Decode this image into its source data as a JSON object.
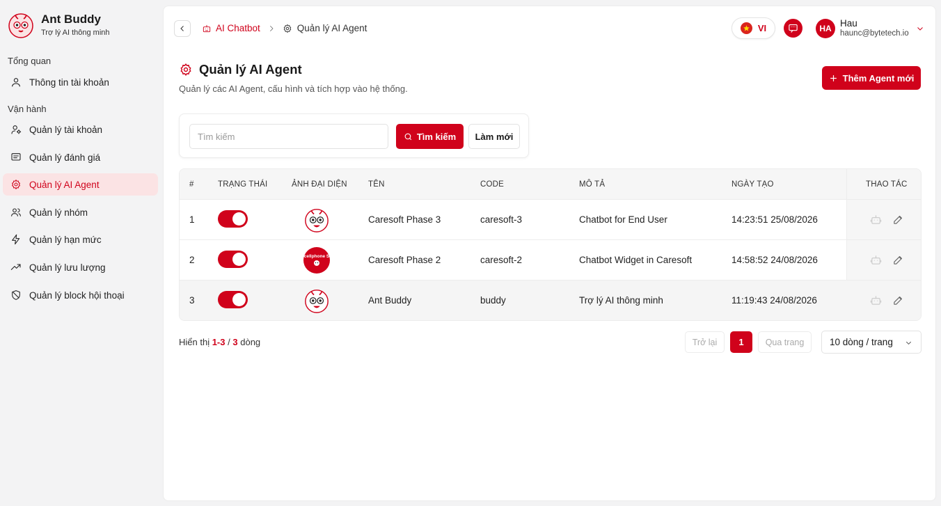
{
  "brand": {
    "name": "Ant Buddy",
    "subtitle": "Trợ lý AI thông minh"
  },
  "sidebar": {
    "section_overview": "Tổng quan",
    "section_operations": "Vận hành",
    "items": [
      {
        "label": "Thông tin tài khoản",
        "icon": "user-icon"
      },
      {
        "label": "Quản lý tài khoản",
        "icon": "user-settings-icon"
      },
      {
        "label": "Quản lý đánh giá",
        "icon": "message-square-icon"
      },
      {
        "label": "Quản lý AI Agent",
        "icon": "gear-icon",
        "active": true
      },
      {
        "label": "Quản lý nhóm",
        "icon": "users-icon"
      },
      {
        "label": "Quản lý hạn mức",
        "icon": "lightning-icon"
      },
      {
        "label": "Quản lý lưu lượng",
        "icon": "trend-up-icon"
      },
      {
        "label": "Quản lý block hội thoại",
        "icon": "shield-off-icon"
      }
    ]
  },
  "breadcrumb": {
    "parent": "AI Chatbot",
    "current": "Quản lý AI Agent"
  },
  "header": {
    "language": "VI",
    "user_initials": "HA",
    "user_name": "Hau",
    "user_email": "haunc@bytetech.io"
  },
  "page": {
    "title": "Quản lý AI Agent",
    "description": "Quản lý các AI Agent, cấu hình và tích hợp vào hệ thống.",
    "add_button": "Thêm Agent mới"
  },
  "search": {
    "placeholder": "Tìm kiếm",
    "value": "",
    "search_button": "Tìm kiếm",
    "refresh_button": "Làm mới"
  },
  "table": {
    "columns": [
      "#",
      "TRẠNG THÁI",
      "ẢNH ĐẠI DIỆN",
      "TÊN",
      "CODE",
      "MÔ TẢ",
      "NGÀY TẠO",
      "THAO TÁC"
    ],
    "rows": [
      {
        "index": "1",
        "enabled": true,
        "avatar": "ant-mascot",
        "name": "Caresoft Phase 3",
        "code": "caresoft-3",
        "description": "Chatbot for End User",
        "created": "14:23:51 25/08/2026"
      },
      {
        "index": "2",
        "enabled": true,
        "avatar": "cellphones-logo",
        "avatar_text": "cellphone S",
        "name": "Caresoft Phase 2",
        "code": "caresoft-2",
        "description": "Chatbot Widget in Caresoft",
        "created": "14:58:52 24/08/2026"
      },
      {
        "index": "3",
        "enabled": true,
        "avatar": "ant-mascot",
        "name": "Ant Buddy",
        "code": "buddy",
        "description": "Trợ lý AI thông minh",
        "created": "11:19:43 24/08/2026"
      }
    ]
  },
  "pagination": {
    "prefix": "Hiển thị",
    "range": "1-3",
    "separator": "/",
    "total": "3",
    "suffix": "dòng",
    "prev": "Trở lại",
    "current_page": "1",
    "next": "Qua trang",
    "page_size": "10 dòng / trang"
  },
  "colors": {
    "accent": "#d0021b",
    "active_bg": "#fbe3e4"
  }
}
